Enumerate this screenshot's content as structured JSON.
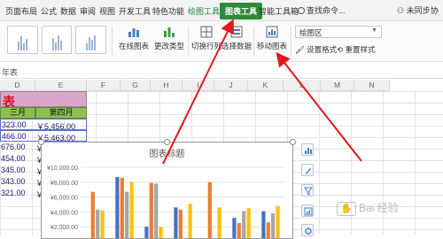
{
  "tabs": [
    {
      "label": "页面布局",
      "state": "normal"
    },
    {
      "label": "公式",
      "state": "normal"
    },
    {
      "label": "数据",
      "state": "normal"
    },
    {
      "label": "审阅",
      "state": "normal"
    },
    {
      "label": "视图",
      "state": "normal"
    },
    {
      "label": "开发工具",
      "state": "normal"
    },
    {
      "label": "特色功能",
      "state": "normal"
    },
    {
      "label": "绘图工具",
      "state": "green"
    },
    {
      "label": "图表工具",
      "state": "active"
    },
    {
      "label": "智能工具箱",
      "state": "normal"
    }
  ],
  "search_label": "查找命令...",
  "sync_label": "未同步",
  "collab_label": "协",
  "ribbon": {
    "online_chart": "在线图表",
    "change_type": "更改类型",
    "switch_rowcol": "切换行列",
    "select_data": "选择数据",
    "move_chart": "移动图表",
    "area_select": "绘图区",
    "set_format": "设置格式",
    "reset_style": "重置样式"
  },
  "formula_text": "年表",
  "columns": [
    "D",
    "E",
    "F",
    "G",
    "H",
    "I",
    "J",
    "K",
    "L",
    "M",
    "N"
  ],
  "sheet": {
    "title": "表",
    "headers": [
      "三月",
      "第四月"
    ],
    "rows": [
      [
        "323.00",
        "￥5,456.00"
      ],
      [
        "466.00",
        "￥5,463.00"
      ],
      [
        "676.00",
        "￥"
      ],
      [
        "454.00",
        "￥"
      ],
      [
        "345.00",
        "￥"
      ],
      [
        "343.00",
        "￥"
      ],
      [
        "321.00",
        "￥"
      ]
    ]
  },
  "chart_data": {
    "type": "bar",
    "title": "图表标题",
    "ylim": [
      0,
      10000
    ],
    "y_ticks": [
      "¥10,000.00",
      "¥8,000.00",
      "¥6,000.00",
      "¥4,000.00",
      "¥2,000.00"
    ],
    "series_colors": [
      "#4472c4",
      "#ed7d31",
      "#a5a5a5",
      "#ffc000"
    ],
    "groups": [
      [
        0,
        6700,
        4300,
        4200
      ],
      [
        8700,
        8600,
        6700,
        8000
      ],
      [
        2000,
        7900,
        7800,
        2000
      ],
      [
        4600,
        4300,
        0,
        5100
      ],
      [
        0,
        8000,
        0,
        4600
      ],
      [
        3200,
        2500,
        4100,
        4500
      ],
      [
        4100,
        2600,
        3800,
        4800
      ]
    ]
  },
  "watermark": "Bai 经验"
}
